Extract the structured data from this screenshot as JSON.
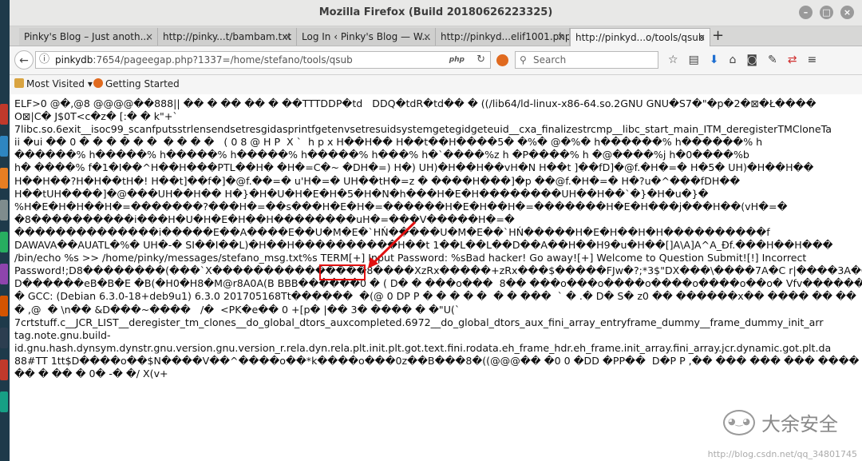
{
  "window": {
    "title": "Mozilla Firefox (Build 20180626223325)"
  },
  "tabs": [
    {
      "label": "Pinky's Blog – Just anoth..."
    },
    {
      "label": "http://pinky...t/bambam.txt"
    },
    {
      "label": "Log In ‹ Pinky's Blog — W..."
    },
    {
      "label": "http://pinkyd...elif1001.php"
    },
    {
      "label": "http://pinkyd...o/tools/qsub"
    }
  ],
  "nav": {
    "url_host": "pinkydb",
    "url_rest": ":7654/pageegap.php?1337=/home/stefano/tools/qsub",
    "url_badge": "php",
    "search_placeholder": "Search"
  },
  "bookmarks": {
    "most_visited": "Most Visited",
    "getting_started": "Getting Started"
  },
  "content": {
    "lines": [
      "ELF>0 @�,@8 @@@@��888|| �� � �� �� � ��TTTDDP�td   DDQ�tdR�td�� � ((/lib64/ld-linux-x86-64.so.2GNU GNU�S7�\"�p�2�⊠�Ł����",
      "O⊠|C� J$0T<c�z� [:� � k\"+`",
      "7libc.so.6exit__isoc99_scanfputsstrlensendsetresgidasprintfgetenvsetresuidsystemgetegidgeteuid__cxa_finalizestrcmp__libc_start_main_ITM_deregisterTMCloneTa",
      "ii �ui �� 0 � � � � � �  � � � �   ( 0 8 @ H P  X `  h p x H��H�� H��t��H����5� �%� @�%� h������% h������% h",
      "������% h�����% h�����% h�����% h�����% h���% h�`����%z h �P����% h �@����%j h�0����%b",
      "h� ����% f�1�I��^H��H���PTL��H� �H�=C�~ �DH�=) H�) UH)�H��H��vH�N H��t ]��fD]�@f.�H�=� H�5� UH)�H��H��",
      "H��H��?H�H��tH�! H��t]��f�]�@f.��=� u'H�=� UH��tH�=z � ����H���]�p ��@f.�H�=� H�?u�^���fDH��",
      "H��tUH����]�@���UH��H�� H�}�H�U�H�E�H�5�H�N�h���H�E�H��������UH��H��`�}�H�u�}�",
      "%H�E�H�H��H�=�������?���H�=��s���H�E�H�=������H�E�H��H�=�������H�E�H���j���H��(vH�=�",
      "�8����������i���H�U�H�E�H��H��������uH�=���V�����H�=�",
      "��������������i�����E��A����E��U�M�E�`HŃ�����U�M�E��`HŃ�����H�E�H��H�H����������f",
      "DAWAVA��AUATL�%� UH�-� SI��I��L)�H��H����������H��t 1��L��L��D��A��H��H9�u�H��[]A\\A]A^A_Ðf.���H��H���",
      "/bin/echo %s >> /home/pinky/messages/stefano_msg.txt%s TERM[+] Input Password: %sBad hacker! Go away![+] Welcome to Question Submit![!] Incorrect",
      "Password!;D8��������(���`X���������������8����XzRx�����+zRx���$�����FJw�?;*3$\"DX���\\����7A�C r|����3A�C .",
      "D������eB�B�E �B(�H0�H8�M@r8A0A(B BBB������0 � ( D� � ���o���  8�� ���o���o����o����o����o��o� Vfv�������",
      "� GCC: (Debian 6.3.0-18+deb9u1) 6.3.0 201705168Tt������  �(@ 0 DP P � � � � �  � � ���  ` � .� D� S� z0 �� ������x�� ���� �� ��",
      "� ,@  � \\n�� &D���~����   /�  <PK�e�� 0 +[p� |�� 3� ���� � �\"U(`",
      "7crtstuff.c__JCR_LIST__deregister_tm_clones__do_global_dtors_auxcompleted.6972__do_global_dtors_aux_fini_array_entryframe_dummy__frame_dummy_init_arr",
      "tag.note.gnu.build-",
      "id.gnu.hash.dynsym.dynstr.gnu.version.gnu.version_r.rela.dyn.rela.plt.init.plt.got.text.fini.rodata.eh_frame_hdr.eh_frame.init_array.fini_array.jcr.dynamic.got.plt.da",
      "88#TT 1tt$D����o��$N����V��^����o��*k����o���0z��B���8�((@@@�� �0 0 �DD �PP��  D�P P ,�� ��� ��� ��� ���� �0� � �",
      "�� � �� � 0� -� �/ X(v+"
    ]
  },
  "watermark": {
    "text": "大余安全",
    "url": "http://blog.csdn.net/qq_34801745"
  },
  "colors": {
    "highlight": "#e01010",
    "arrow": "#e01010"
  }
}
